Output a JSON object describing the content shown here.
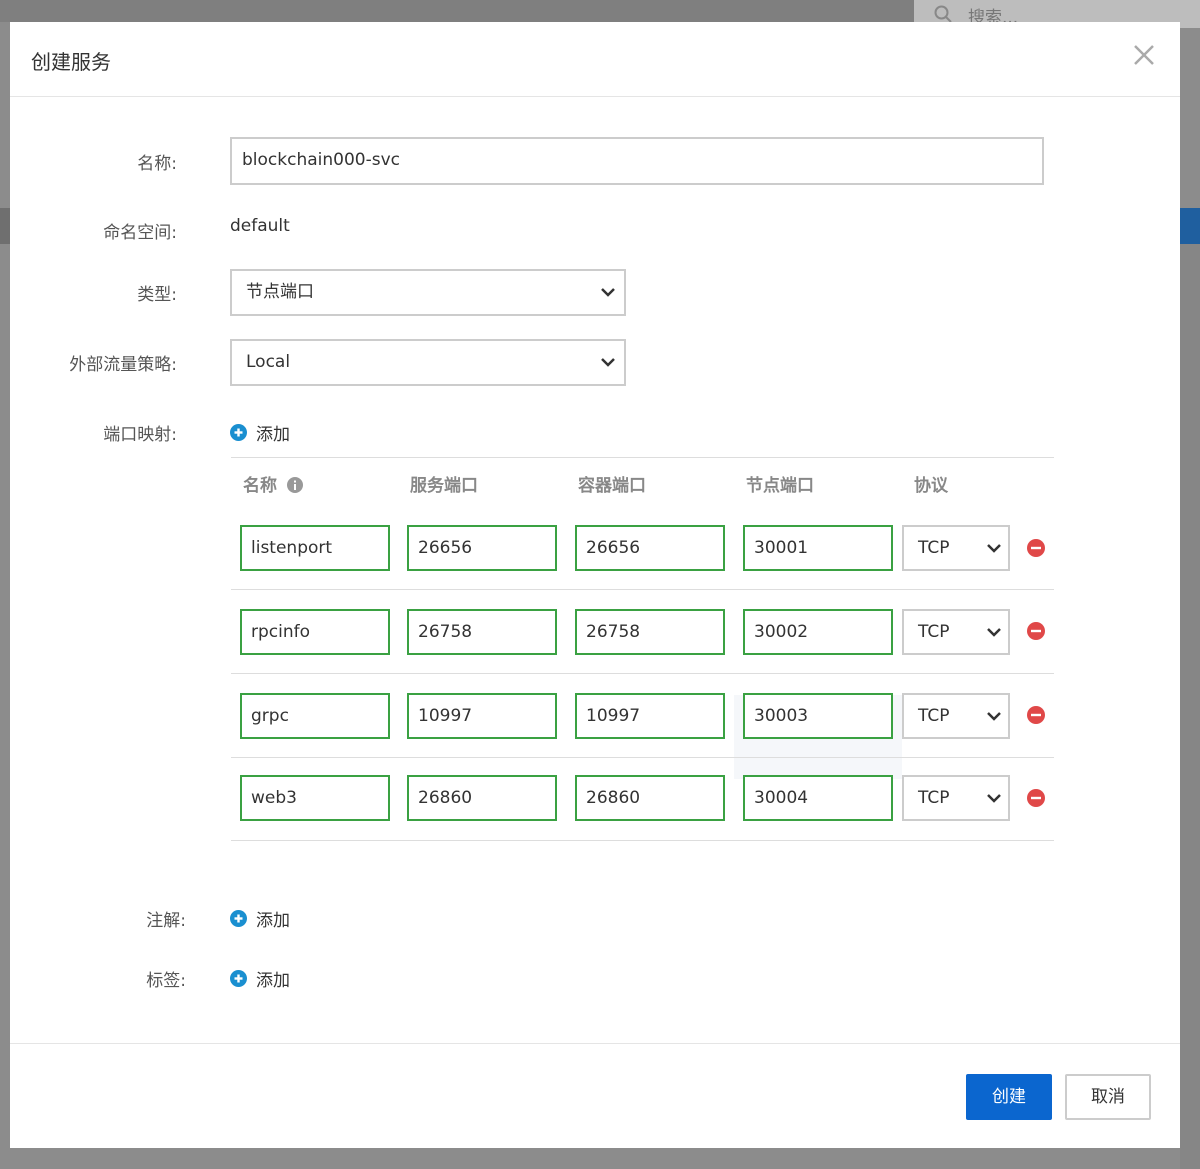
{
  "search": {
    "placeholder": "搜索..."
  },
  "dialog": {
    "title": "创建服务",
    "labels": {
      "name": "名称:",
      "namespace": "命名空间:",
      "type": "类型:",
      "traffic_policy": "外部流量策略:",
      "port_mapping": "端口映射:",
      "annotations": "注解:",
      "tags": "标签:"
    },
    "fields": {
      "name": "blockchain000-svc",
      "namespace": "default",
      "type": "节点端口",
      "traffic_policy": "Local"
    },
    "add_label": "添加",
    "ports": {
      "headers": {
        "name": "名称",
        "service_port": "服务端口",
        "container_port": "容器端口",
        "node_port": "节点端口",
        "protocol": "协议"
      },
      "rows": [
        {
          "name": "listenport",
          "service_port": "26656",
          "container_port": "26656",
          "node_port": "30001",
          "protocol": "TCP"
        },
        {
          "name": "rpcinfo",
          "service_port": "26758",
          "container_port": "26758",
          "node_port": "30002",
          "protocol": "TCP"
        },
        {
          "name": "grpc",
          "service_port": "10997",
          "container_port": "10997",
          "node_port": "30003",
          "protocol": "TCP"
        },
        {
          "name": "web3",
          "service_port": "26860",
          "container_port": "26860",
          "node_port": "30004",
          "protocol": "TCP"
        }
      ]
    },
    "footer": {
      "create": "创建",
      "cancel": "取消"
    }
  },
  "colors": {
    "primary": "#0b66cf",
    "valid_border": "#3aa142",
    "add_icon": "#1a8fd0",
    "remove_icon": "#e04848"
  }
}
